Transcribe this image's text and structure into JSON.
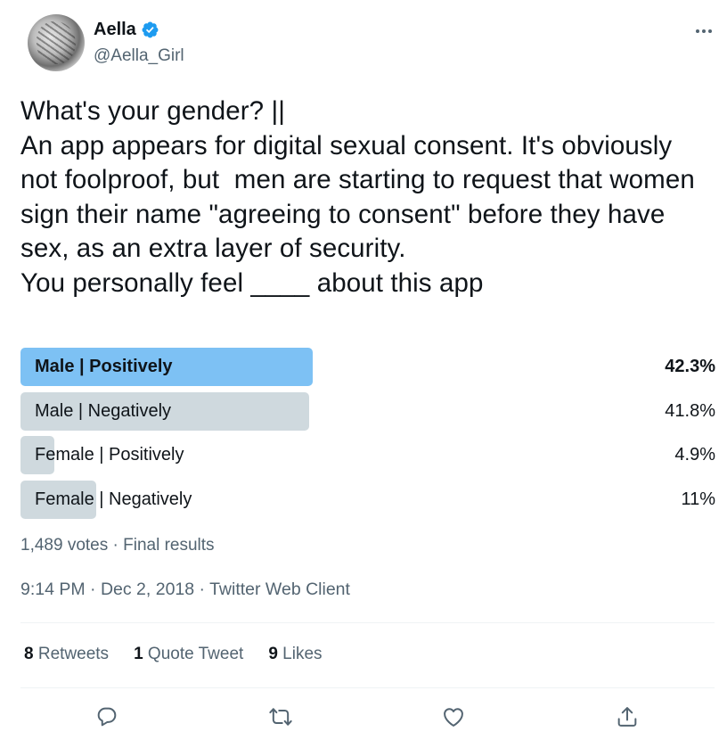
{
  "author": {
    "name": "Aella",
    "handle": "@Aella_Girl",
    "verified": true
  },
  "tweet": {
    "text": "What's your gender? ||\nAn app appears for digital sexual consent. It's obviously not foolproof, but  men are starting to request that women sign their name \"agreeing to consent\" before they have sex, as an extra layer of security.\nYou personally feel ____ about this app"
  },
  "poll": {
    "options": [
      {
        "label": "Male | Positively",
        "percent": "42.3%",
        "value": 42.3,
        "winner": true
      },
      {
        "label": "Male | Negatively",
        "percent": "41.8%",
        "value": 41.8,
        "winner": false
      },
      {
        "label": "Female | Positively",
        "percent": "4.9%",
        "value": 4.9,
        "winner": false
      },
      {
        "label": "Female | Negatively",
        "percent": "11%",
        "value": 11,
        "winner": false
      }
    ],
    "meta": "1,489 votes · Final results"
  },
  "timestamp": "9:14 PM · Dec 2, 2018 · Twitter Web Client",
  "stats": {
    "retweets_count": "8",
    "retweets_label": "Retweets",
    "quotes_count": "1",
    "quotes_label": "Quote Tweet",
    "likes_count": "9",
    "likes_label": "Likes"
  },
  "colors": {
    "accent": "#1d9bf0",
    "winner_bar": "#7dc1f4",
    "bar": "#cfd9de",
    "secondary_text": "#536471"
  },
  "icons": [
    "verified-badge-icon",
    "more-icon",
    "reply-icon",
    "retweet-icon",
    "like-icon",
    "share-icon"
  ]
}
